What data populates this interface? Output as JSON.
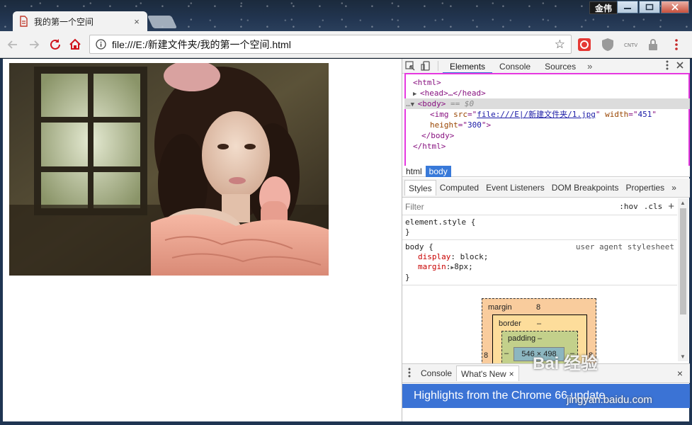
{
  "window": {
    "tab_title": "我的第一个空间",
    "tab_close": "×",
    "user_name": "金伟",
    "minimize": "–",
    "maximize": "□",
    "close": "✕"
  },
  "toolbar": {
    "url": "file:///E:/新建文件夹/我的第一个空间.html",
    "star": "☆",
    "extensions": [
      "pdf-icon",
      "shield-icon",
      "cntv-icon",
      "lock-icon",
      "menu-icon"
    ]
  },
  "page": {
    "image": {
      "src": "file:///E|/新建文件夹/1.jpg",
      "width": "451",
      "height": "300",
      "alt": "photo of woman"
    }
  },
  "devtools": {
    "tabs": [
      "Elements",
      "Console",
      "Sources"
    ],
    "more": "»",
    "active_tab": "Elements",
    "dom": {
      "l1": "<html>",
      "l2_tag": "<head>",
      "l2_rest": "…</head>",
      "l3_tag": "<body>",
      "l3_ref": "== $0",
      "l4_tag": "<img",
      "l4_attr1": "src",
      "l4_val1": "file:///E|/新建文件夹/1.jpg",
      "l4_attr2": "width",
      "l4_val2": "451",
      "l5_attr": "height",
      "l5_val": "300",
      "l5_close": ">",
      "l6": "</body>",
      "l7": "</html>"
    },
    "breadcrumbs": [
      "html",
      "body"
    ],
    "style_tabs": [
      "Styles",
      "Computed",
      "Event Listeners",
      "DOM Breakpoints",
      "Properties"
    ],
    "style_more": "»",
    "filter": {
      "placeholder": "Filter",
      "hov": ":hov",
      "cls": ".cls",
      "plus": "+"
    },
    "rules": {
      "element_style": "element.style {",
      "element_close": "}",
      "body_sel": "body {",
      "body_origin": "user agent stylesheet",
      "display_name": "display",
      "display_val": "block;",
      "margin_name": "margin",
      "margin_val": "8px;",
      "body_close": "}"
    },
    "box_model": {
      "margin_label": "margin",
      "margin_val": "8",
      "border_label": "border",
      "border_val": "–",
      "padding_label": "padding",
      "padding_val": "–",
      "content": "546 × 498",
      "left": "8",
      "right": "8",
      "left_pad": "–",
      "right_pad": "–"
    },
    "drawer": {
      "tabs": [
        "Console",
        "What's New"
      ],
      "tab_x": "×",
      "close": "×",
      "highlights": "Highlights from the Chrome 66 update"
    }
  },
  "watermark": {
    "brand": "Bai 经验",
    "url": "jingyan.baidu.com"
  }
}
